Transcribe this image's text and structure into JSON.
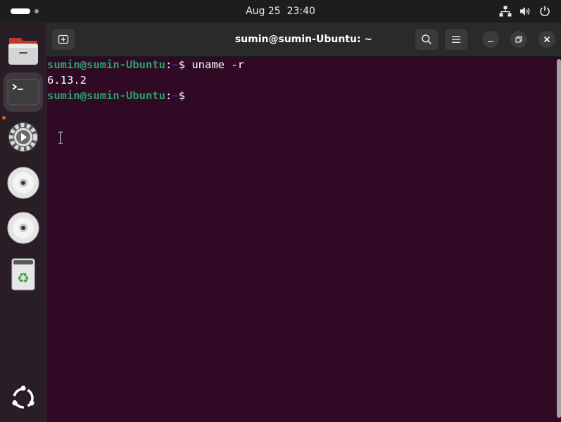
{
  "topbar": {
    "clock_date": "Aug 25",
    "clock_time": "23:40",
    "tray_icons": [
      "network-icon",
      "volume-icon",
      "power-icon"
    ]
  },
  "dock": {
    "items": [
      {
        "name": "files",
        "icon": "folder-icon"
      },
      {
        "name": "terminal",
        "icon": "terminal-icon",
        "active": true
      },
      {
        "name": "software",
        "icon": "software-updater-icon"
      },
      {
        "name": "disc-1",
        "icon": "optical-disc-icon"
      },
      {
        "name": "disc-2",
        "icon": "optical-disc-icon"
      },
      {
        "name": "trash",
        "icon": "trash-icon"
      },
      {
        "name": "show-apps",
        "icon": "ubuntu-logo-icon"
      }
    ]
  },
  "window": {
    "title": "sumin@sumin-Ubuntu: ~"
  },
  "terminal": {
    "lines": [
      {
        "user_host": "sumin@sumin-Ubuntu",
        "sep": ":",
        "path": "~",
        "symbol": "$ ",
        "command": "uname -r"
      },
      {
        "output": "6.13.2"
      },
      {
        "user_host": "sumin@sumin-Ubuntu",
        "sep": ":",
        "path": "~",
        "symbol": "$",
        "command": ""
      }
    ]
  },
  "colors": {
    "terminal_bg": "#300a24",
    "prompt_user": "#26a269",
    "prompt_path": "#12488b",
    "accent": "#e95420"
  }
}
